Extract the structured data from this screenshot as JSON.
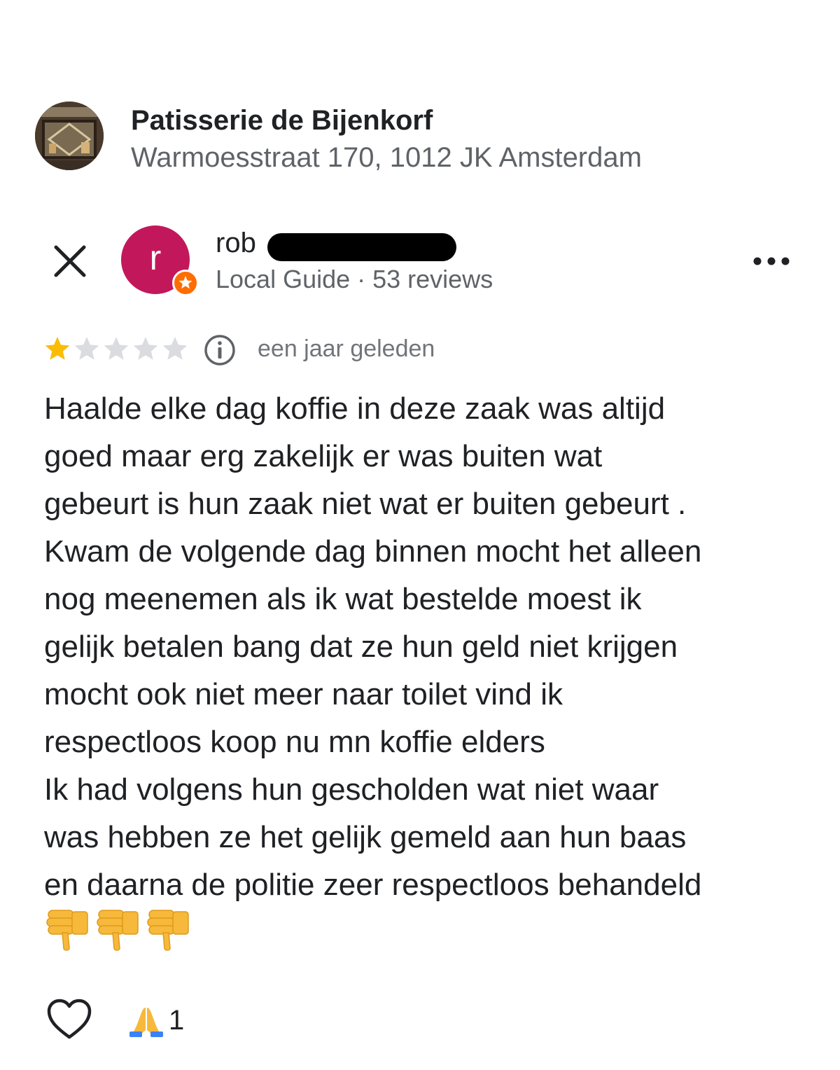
{
  "place": {
    "name": "Patisserie de Bijenkorf",
    "address": "Warmoesstraat 170, 1012 JK Amsterdam"
  },
  "reviewer": {
    "initial": "r",
    "name": "rob",
    "meta": "Local Guide · 53 reviews"
  },
  "review": {
    "rating": 1,
    "max_rating": 5,
    "time": "een jaar geleden",
    "text": "Haalde elke dag koffie in deze zaak was altijd\ngoed maar erg zakelijk er was buiten wat\ngebeurt is hun zaak niet wat er buiten gebeurt .\nKwam de volgende dag binnen mocht het alleen\nnog meenemen  als ik wat bestelde moest ik\ngelijk betalen bang dat ze hun geld niet krijgen\nmocht ook niet meer naar toilet vind ik\nrespectloos koop nu mn koffie elders\nIk had volgens hun gescholden wat niet waar\nwas hebben ze het gelijk gemeld aan hun baas\nen daarna de politie zeer respectloos behandeld",
    "emoji_count": 3
  },
  "reactions": {
    "pray_count": "1"
  },
  "colors": {
    "avatar": "#c2185b",
    "badge": "#ff6d00",
    "star_filled": "#fbbc04",
    "star_empty": "#dadce0"
  }
}
